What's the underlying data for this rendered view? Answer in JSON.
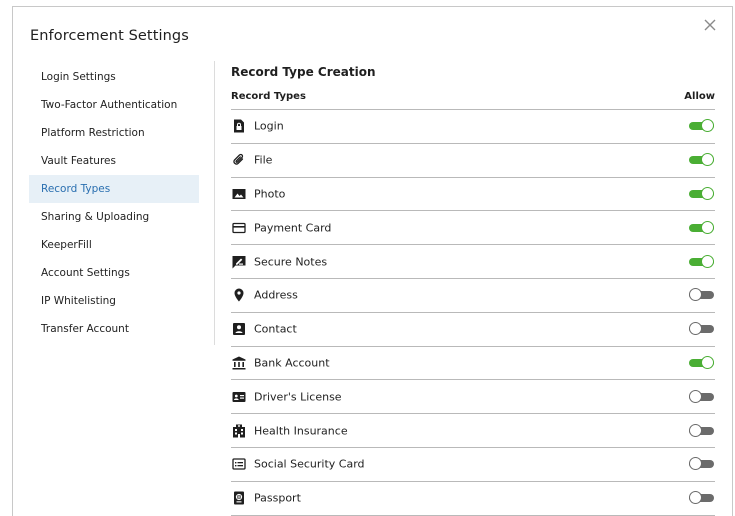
{
  "dialog": {
    "title": "Enforcement Settings",
    "close_icon": "close-icon"
  },
  "sidebar": {
    "items": [
      {
        "label": "Login Settings",
        "active": false
      },
      {
        "label": "Two-Factor Authentication",
        "active": false
      },
      {
        "label": "Platform Restriction",
        "active": false
      },
      {
        "label": "Vault Features",
        "active": false
      },
      {
        "label": "Record Types",
        "active": true
      },
      {
        "label": "Sharing & Uploading",
        "active": false
      },
      {
        "label": "KeeperFill",
        "active": false
      },
      {
        "label": "Account Settings",
        "active": false
      },
      {
        "label": "IP Whitelisting",
        "active": false
      },
      {
        "label": "Transfer Account",
        "active": false
      }
    ]
  },
  "content": {
    "section_title": "Record Type Creation",
    "col_record_types": "Record Types",
    "col_allow": "Allow",
    "rows": [
      {
        "label": "Login",
        "icon": "login-icon",
        "allowed": true
      },
      {
        "label": "File",
        "icon": "paperclip-icon",
        "allowed": true
      },
      {
        "label": "Photo",
        "icon": "photo-icon",
        "allowed": true
      },
      {
        "label": "Payment Card",
        "icon": "credit-card-icon",
        "allowed": true
      },
      {
        "label": "Secure Notes",
        "icon": "secure-note-icon",
        "allowed": true
      },
      {
        "label": "Address",
        "icon": "location-pin-icon",
        "allowed": false
      },
      {
        "label": "Contact",
        "icon": "contact-icon",
        "allowed": false
      },
      {
        "label": "Bank Account",
        "icon": "bank-icon",
        "allowed": true
      },
      {
        "label": "Driver's License",
        "icon": "id-card-icon",
        "allowed": false
      },
      {
        "label": "Health Insurance",
        "icon": "hospital-icon",
        "allowed": false
      },
      {
        "label": "Social Security Card",
        "icon": "ssn-card-icon",
        "allowed": false
      },
      {
        "label": "Passport",
        "icon": "passport-icon",
        "allowed": false
      }
    ]
  },
  "colors": {
    "toggle_on": "#4aae34",
    "toggle_off": "#6b6b6b",
    "active_bg": "#e7f0f7",
    "active_text": "#2a6fb0"
  }
}
